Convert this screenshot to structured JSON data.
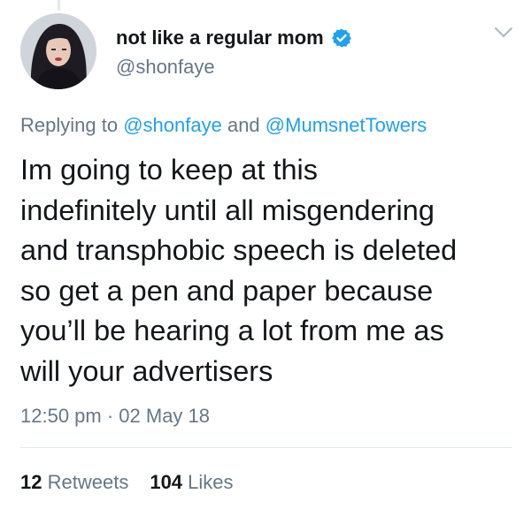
{
  "author": {
    "display_name": "not like a regular mom",
    "handle": "@shonfaye",
    "verified": true
  },
  "reply_context": {
    "prefix": "Replying to",
    "mention_1": "@shonfaye",
    "conjunction": "and",
    "mention_2": "@MumsnetTowers"
  },
  "tweet": {
    "lines": [
      "Im going to keep at this",
      "indefinitely until all misgendering",
      "and transphobic speech is deleted",
      "so get a pen and paper because",
      "you’ll be hearing a lot from me as",
      "will your advertisers"
    ],
    "timestamp": "12:50 pm · 02 May 18"
  },
  "stats": {
    "retweets_count": "12",
    "retweets_label": "Retweets",
    "likes_count": "104",
    "likes_label": "Likes"
  },
  "icons": {
    "verified": "verified-badge-icon",
    "menu": "chevron-down-icon"
  },
  "colors": {
    "accent": "#1da1f2",
    "text_primary": "#14171a",
    "text_secondary": "#657786",
    "divider": "#e1e8ed"
  }
}
